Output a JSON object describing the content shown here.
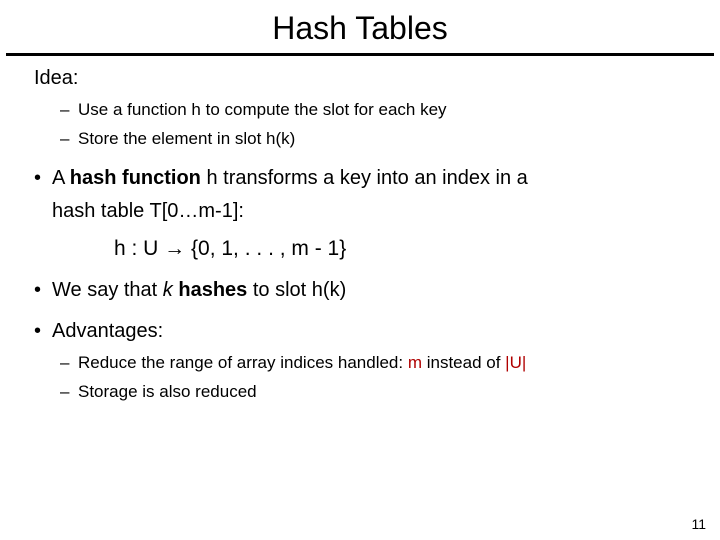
{
  "title": "Hash Tables",
  "idea_label": "Idea:",
  "sub1_pre": "Use a function ",
  "sub1_h": "h",
  "sub1_post": " to compute the slot for each key",
  "sub2_pre": "Store the element in slot ",
  "sub2_hk": "h(k)",
  "b1_a": "A ",
  "b1_hf": "hash function",
  "b1_b": " h transforms a key into an index in a",
  "b1_cont_pre": "hash table ",
  "b1_cont_t": "T[0…m-1]:",
  "formula": "h : U → {0, 1, . . . , m - 1}",
  "b2_a": "We say that ",
  "b2_k": "k",
  "b2_b": " ",
  "b2_hashes": "hashes",
  "b2_c": " to slot ",
  "b2_hk": "h(k)",
  "adv_label": "Advantages:",
  "adv1_pre": "Reduce the range of array indices handled: ",
  "adv1_m": "m",
  "adv1_mid": " instead of ",
  "adv1_u": "|U|",
  "adv2": "Storage is also reduced",
  "page": "11",
  "dash": "–",
  "dot": "•"
}
